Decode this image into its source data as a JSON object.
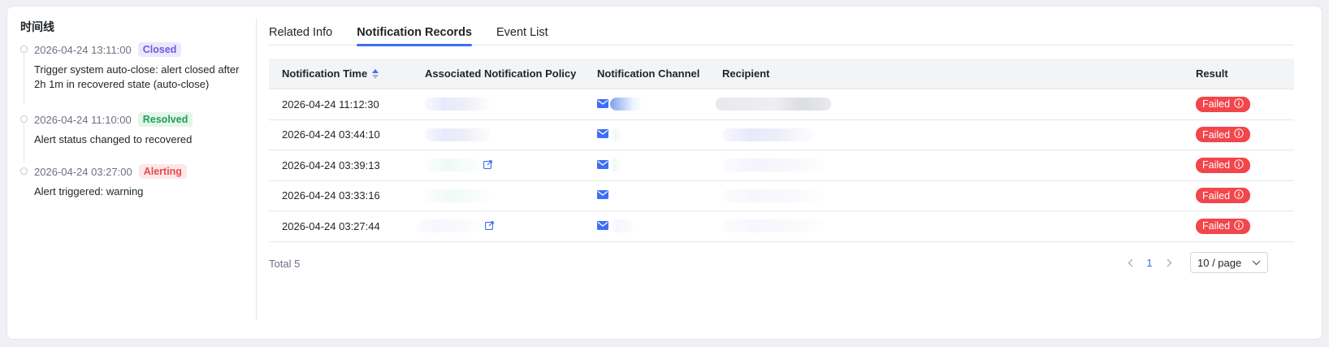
{
  "timeline": {
    "title": "时间线",
    "items": [
      {
        "time": "2026-04-24 13:11:00",
        "badge": "Closed",
        "badge_bg": "#ebe8fb",
        "badge_fg": "#6b5ce0",
        "desc": "Trigger system auto-close: alert closed after 2h 1m in recovered state (auto-close)"
      },
      {
        "time": "2026-04-24 11:10:00",
        "badge": "Resolved",
        "badge_bg": "#e3f6ea",
        "badge_fg": "#1e9e55",
        "desc": "Alert status changed to recovered"
      },
      {
        "time": "2026-04-24 03:27:00",
        "badge": "Alerting",
        "badge_bg": "#fde8e8",
        "badge_fg": "#ea4a4a",
        "desc": "Alert triggered: warning"
      }
    ]
  },
  "tabs": [
    {
      "label": "Related Info",
      "active": false
    },
    {
      "label": "Notification Records",
      "active": true
    },
    {
      "label": "Event List",
      "active": false
    }
  ],
  "table": {
    "headers": {
      "time": "Notification Time",
      "policy": "Associated Notification Policy",
      "channel": "Notification Channel",
      "recipient": "Recipient",
      "result": "Result"
    },
    "rows": [
      {
        "time": "2026-04-24 11:12:30",
        "result": "Failed"
      },
      {
        "time": "2026-04-24 03:44:10",
        "result": "Failed"
      },
      {
        "time": "2026-04-24 03:39:13",
        "result": "Failed"
      },
      {
        "time": "2026-04-24 03:33:16",
        "result": "Failed"
      },
      {
        "time": "2026-04-24 03:27:44",
        "result": "Failed"
      }
    ]
  },
  "footer": {
    "total": "Total 5",
    "current_page": "1",
    "page_size": "10 / page"
  },
  "colors": {
    "accent": "#3d6ef5",
    "failed": "#f2464b"
  }
}
